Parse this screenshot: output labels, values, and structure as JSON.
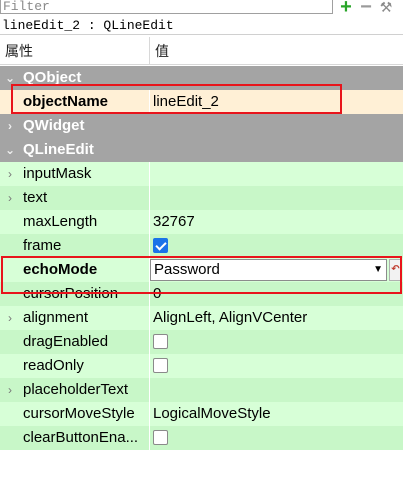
{
  "filter": {
    "placeholder": "Filter",
    "add_symbol": "+",
    "remove_symbol": "−",
    "config_symbol": "⚒"
  },
  "object_title": "lineEdit_2 : QLineEdit",
  "header": {
    "property": "属性",
    "value": "值"
  },
  "sections": {
    "qobject": {
      "name": "QObject",
      "expander": "⌄"
    },
    "qwidget": {
      "name": "QWidget",
      "expander": "›"
    },
    "qlineedit": {
      "name": "QLineEdit",
      "expander": "⌄"
    }
  },
  "properties": {
    "objectName": {
      "name": "objectName",
      "value": "lineEdit_2"
    },
    "inputMask": {
      "name": "inputMask",
      "value": "",
      "expander": "›"
    },
    "text": {
      "name": "text",
      "value": "",
      "expander": "›"
    },
    "maxLength": {
      "name": "maxLength",
      "value": "32767"
    },
    "frame": {
      "name": "frame",
      "checked": true
    },
    "echoMode": {
      "name": "echoMode",
      "value": "Password",
      "arrow": "▼",
      "reset": "↶"
    },
    "cursorPosition": {
      "name": "cursorPosition",
      "value": "0"
    },
    "alignment": {
      "name": "alignment",
      "value": "AlignLeft, AlignVCenter",
      "expander": "›"
    },
    "dragEnabled": {
      "name": "dragEnabled",
      "checked": false
    },
    "readOnly": {
      "name": "readOnly",
      "checked": false
    },
    "placeholderText": {
      "name": "placeholderText",
      "value": "",
      "expander": "›"
    },
    "cursorMoveStyle": {
      "name": "cursorMoveStyle",
      "value": "LogicalMoveStyle"
    },
    "clearButtonEnabled": {
      "name": "clearButtonEna...",
      "checked": false
    }
  },
  "colors": {
    "section_bg": "#a4a4a4",
    "object_row_bg": "#fff0d6",
    "widget_row_bg": "#d7ffd7",
    "widget_row_alt_bg": "#c8f7c8",
    "highlight": "#e8141b",
    "checkbox_checked": "#1a73e8"
  }
}
